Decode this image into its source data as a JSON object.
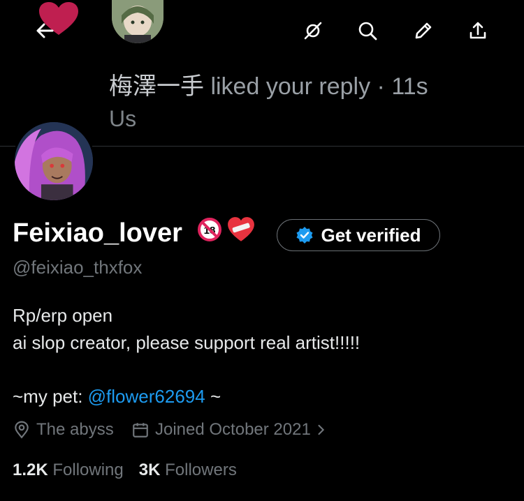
{
  "header": {
    "icons": [
      "back-arrow-icon",
      "no-notification-icon",
      "search-icon",
      "edit-icon",
      "share-icon"
    ]
  },
  "notification": {
    "actor": "梅澤一手",
    "text": " liked your reply · 11s",
    "sub": "Us"
  },
  "profile": {
    "display_name": "Feixiao_lover",
    "verify_label": "Get verified",
    "handle": "@feixiao_thxfox",
    "bio_line1": "Rp/erp open",
    "bio_line2": "ai slop creator, please support real artist!!!!!",
    "pet_prefix": "~my pet: ",
    "pet_link": "@flower62694",
    "pet_suffix": " ~",
    "location": "The abyss",
    "joined": "Joined October 2021",
    "following_count": "1.2K",
    "following_label": "Following",
    "followers_count": "3K",
    "followers_label": "Followers"
  },
  "colors": {
    "accent": "#1d9bf0",
    "muted": "#71767b",
    "heart": "#e0245e"
  }
}
